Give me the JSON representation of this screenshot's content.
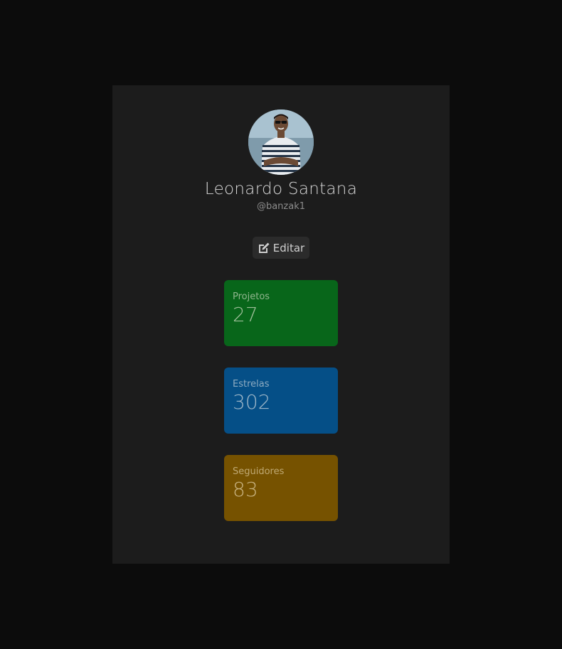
{
  "profile": {
    "name": "Leonardo Santana",
    "handle": "@banzak1",
    "avatar_icon": "user-photo"
  },
  "actions": {
    "edit_label": "Editar",
    "edit_icon": "edit-icon"
  },
  "stats": [
    {
      "label": "Projetos",
      "value": "27",
      "color": "#08661a"
    },
    {
      "label": "Estrelas",
      "value": "302",
      "color": "#054f87"
    },
    {
      "label": "Seguidores",
      "value": "83",
      "color": "#765200"
    }
  ],
  "colors": {
    "page_background": "#0c0c0c",
    "card_background": "#1c1c1c",
    "button_background": "#2b2b2b"
  }
}
